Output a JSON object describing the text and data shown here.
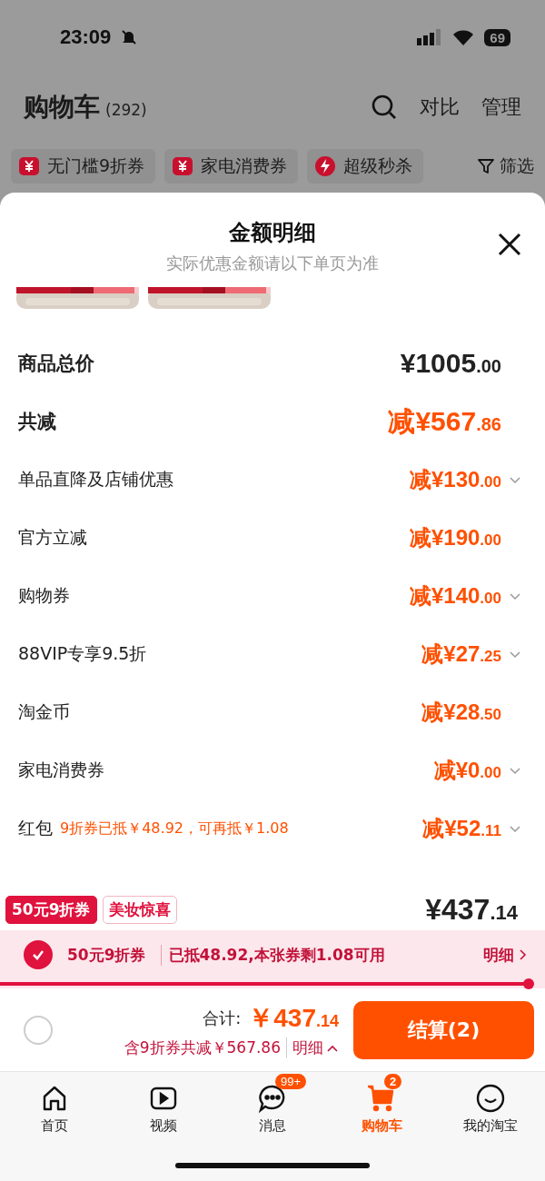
{
  "status_bar": {
    "time": "23:09",
    "battery": "69"
  },
  "header": {
    "title": "购物车",
    "count": "(292)",
    "actions": [
      "对比",
      "管理"
    ]
  },
  "filter_chips": [
    {
      "label": "无门槛9折券",
      "kind": "coupon"
    },
    {
      "label": "家电消费券",
      "kind": "coupon"
    },
    {
      "label": "超级秒杀",
      "kind": "flash"
    }
  ],
  "filter_button": "筛选",
  "sheet": {
    "title": "金额明细",
    "subtitle": "实际优惠金额请以下单页为准",
    "rows": [
      {
        "kind": "total",
        "label": "商品总价",
        "amount": "¥1005.00",
        "expandable": false,
        "discount": false
      },
      {
        "kind": "total",
        "label": "共减",
        "amount": "减¥567.86",
        "expandable": false,
        "discount": true
      },
      {
        "kind": "detail",
        "label": "单品直降及店铺优惠",
        "amount": "减¥130.00",
        "expandable": true,
        "discount": true
      },
      {
        "kind": "detail",
        "label": "官方立减",
        "amount": "减¥190.00",
        "expandable": false,
        "discount": true
      },
      {
        "kind": "detail",
        "label": "购物券",
        "amount": "减¥140.00",
        "expandable": true,
        "discount": true
      },
      {
        "kind": "detail",
        "label": "88VIP专享9.5折",
        "amount": "减¥27.25",
        "expandable": true,
        "discount": true
      },
      {
        "kind": "detail",
        "label": "淘金币",
        "amount": "减¥28.50",
        "expandable": false,
        "discount": true
      },
      {
        "kind": "detail",
        "label": "家电消费券",
        "amount": "减¥0.00",
        "expandable": true,
        "discount": true
      },
      {
        "kind": "detail",
        "label": "红包",
        "note": "9折券已抵￥48.92，可再抵￥1.08",
        "amount": "减¥52.11",
        "expandable": true,
        "discount": true
      }
    ]
  },
  "item_tags": [
    {
      "label": "50元9折券",
      "kind": "solid"
    },
    {
      "label": "美妆惊喜",
      "kind": "outline"
    }
  ],
  "item_price": "¥437.14",
  "coupon_bar": {
    "checked": true,
    "name": "50元9折券",
    "info": "已抵48.92,本张券剩1.08可用",
    "link": "明细",
    "level": 0.97
  },
  "footer": {
    "select_all_checked": false,
    "total_label": "合计:",
    "total": "￥437.14",
    "savings": "含9折券共减￥567.86",
    "detail_link": "明细",
    "checkout": "结算(2)"
  },
  "tab_bar": [
    {
      "label": "首页",
      "kind": "home",
      "selected": false
    },
    {
      "label": "视频",
      "kind": "video",
      "selected": false
    },
    {
      "label": "消息",
      "kind": "chat",
      "selected": false,
      "badge": "99+"
    },
    {
      "label": "购物车",
      "kind": "cart",
      "selected": true,
      "badge": "2"
    },
    {
      "label": "我的淘宝",
      "kind": "face",
      "selected": false
    }
  ]
}
